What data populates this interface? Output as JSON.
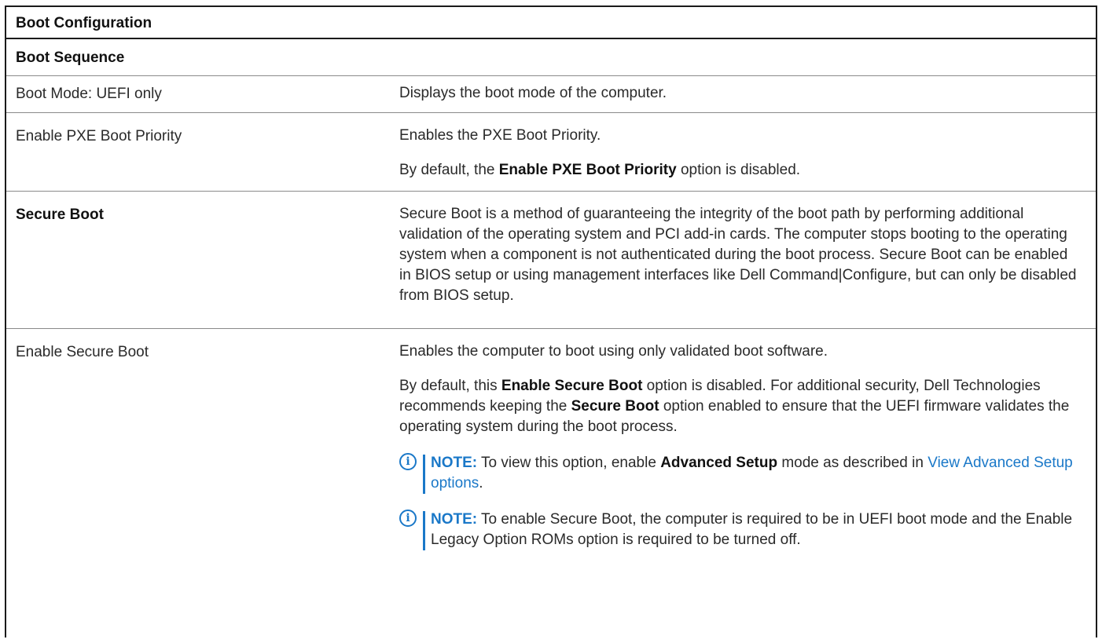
{
  "table": {
    "title": "Boot Configuration",
    "section": "Boot Sequence",
    "rows": [
      {
        "setting": "Boot Mode: UEFI only",
        "desc1": "Displays the boot mode of the computer."
      },
      {
        "setting": "Enable PXE Boot Priority",
        "desc1": "Enables the PXE Boot Priority.",
        "desc2_pre": "By default, the ",
        "desc2_bold": "Enable PXE Boot Priority",
        "desc2_post": " option is disabled."
      },
      {
        "setting": "Secure Boot",
        "desc1": "Secure Boot is a method of guaranteeing the integrity of the boot path by performing additional validation of the operating system and PCI add-in cards. The computer stops booting to the operating system when a component is not authenticated during the boot process. Secure Boot can be enabled in BIOS setup or using management interfaces like Dell Command|Configure, but can only be disabled from BIOS setup."
      },
      {
        "setting": "Enable Secure Boot",
        "desc1": "Enables the computer to boot using only validated boot software.",
        "desc2_a": "By default, this ",
        "desc2_b": "Enable Secure Boot",
        "desc2_c": " option is disabled. For additional security, Dell Technologies recommends keeping the ",
        "desc2_d": "Secure Boot",
        "desc2_e": " option enabled to ensure that the UEFI firmware validates the operating system during the boot process.",
        "note1_label": "NOTE:",
        "note1_pre": " To view this option, enable ",
        "note1_bold": "Advanced Setup",
        "note1_post": " mode as described in ",
        "note1_link": "View Advanced Setup options",
        "note1_end": ".",
        "note2_label": "NOTE:",
        "note2_text": " To enable Secure Boot, the computer is required to be in UEFI boot mode and the Enable Legacy Option ROMs option is required to be turned off."
      }
    ]
  },
  "colors": {
    "note_accent": "#1a78c8",
    "border": "#1a1a1a"
  },
  "icons": {
    "note": "info-icon"
  }
}
